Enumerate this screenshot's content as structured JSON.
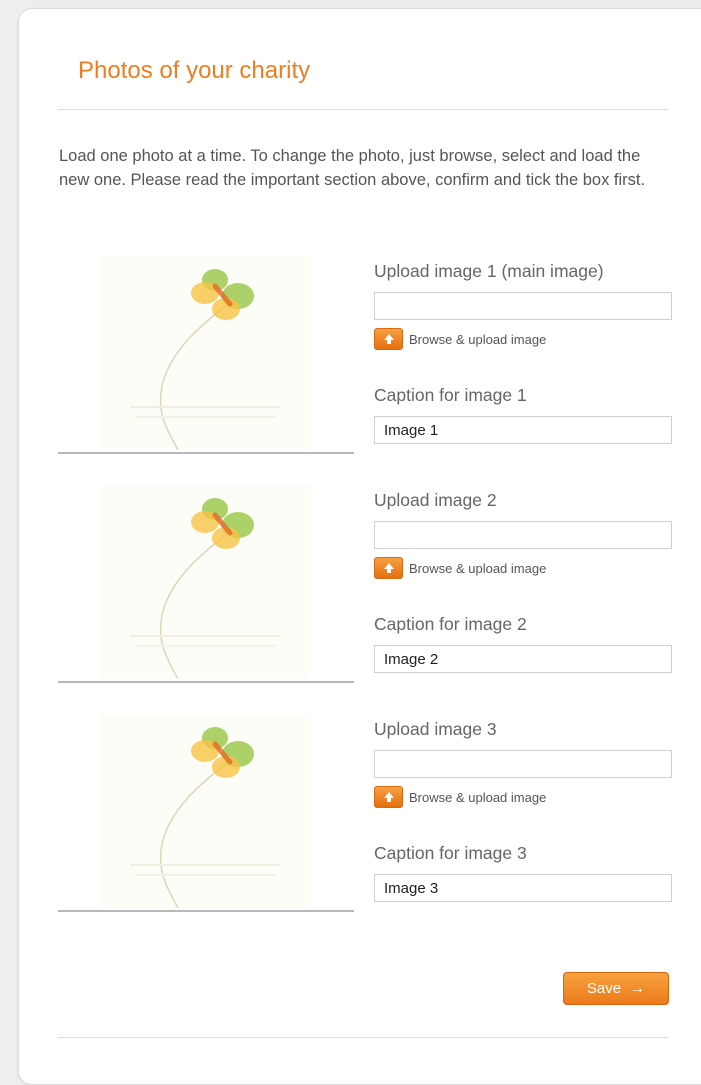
{
  "section": {
    "title": "Photos of your charity",
    "intro": "Load one photo at a time. To change the photo, just browse, select and load the new one. Please read the important section above, confirm and tick the box first."
  },
  "photos": [
    {
      "upload_label": "Upload image 1 (main image)",
      "upload_value": "",
      "browse_label": "Browse & upload image",
      "caption_label": "Caption for image 1",
      "caption_value": "Image 1"
    },
    {
      "upload_label": "Upload image 2",
      "upload_value": "",
      "browse_label": "Browse & upload image",
      "caption_label": "Caption for image 2",
      "caption_value": "Image 2"
    },
    {
      "upload_label": "Upload image 3",
      "upload_value": "",
      "browse_label": "Browse & upload image",
      "caption_label": "Caption for image 3",
      "caption_value": "Image 3"
    }
  ],
  "actions": {
    "save_label": "Save",
    "save_icon": "arrow-right-icon"
  },
  "icons": {
    "browse": "upload-arrow-icon",
    "placeholder": "butterfly-placeholder-icon"
  },
  "colors": {
    "accent": "#ee7d22",
    "title": "#ee7d22",
    "text": "#555555",
    "border": "#cfcfcf"
  }
}
